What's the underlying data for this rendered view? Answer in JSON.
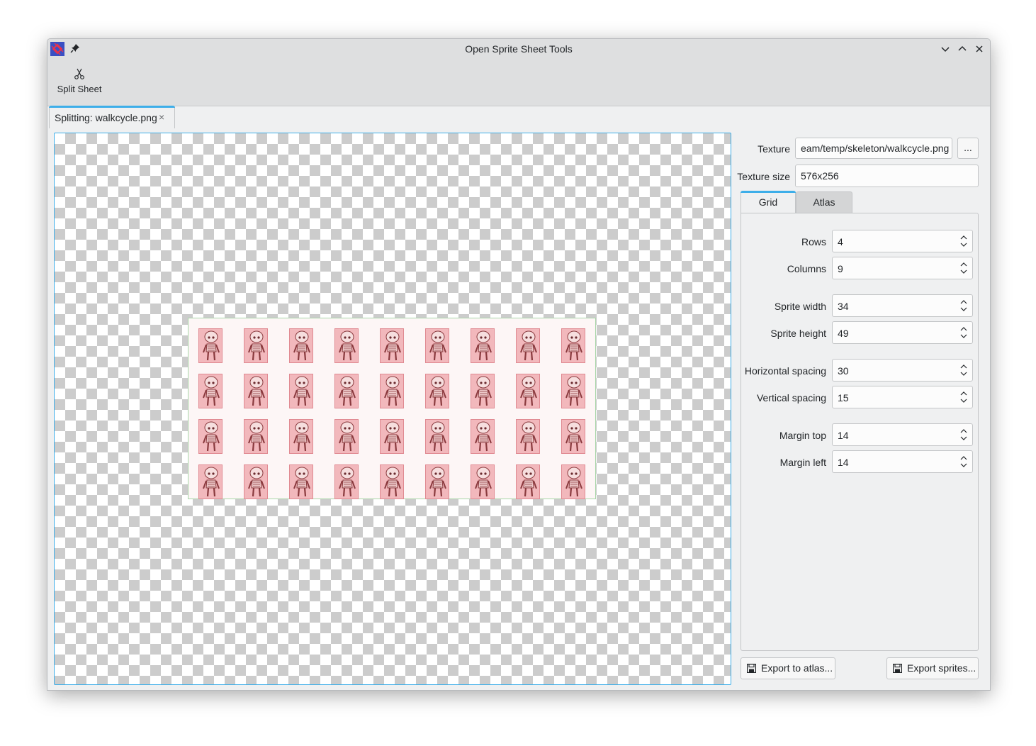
{
  "window": {
    "title": "Open Sprite Sheet Tools"
  },
  "toolbar": {
    "split_label": "Split Sheet"
  },
  "tab": {
    "label": "Splitting: walkcycle.png",
    "close_glyph": "×"
  },
  "texture": {
    "label": "Texture",
    "path": "eam/temp/skeleton/walkcycle.png",
    "browse_label": "...",
    "size_label": "Texture size",
    "size_value": "576x256"
  },
  "mode_tabs": {
    "grid": "Grid",
    "atlas": "Atlas"
  },
  "grid": {
    "rows": {
      "label": "Rows",
      "value": "4"
    },
    "columns": {
      "label": "Columns",
      "value": "9"
    },
    "sprite_width": {
      "label": "Sprite width",
      "value": "34"
    },
    "sprite_height": {
      "label": "Sprite height",
      "value": "49"
    },
    "h_spacing": {
      "label": "Horizontal spacing",
      "value": "30"
    },
    "v_spacing": {
      "label": "Vertical spacing",
      "value": "15"
    },
    "margin_top": {
      "label": "Margin top",
      "value": "14"
    },
    "margin_left": {
      "label": "Margin left",
      "value": "14"
    }
  },
  "actions": {
    "export_atlas": "Export to atlas...",
    "export_sprites": "Export sprites..."
  },
  "colors": {
    "accent": "#3daee9",
    "sprite_fill": "#f2b8bc",
    "sheet_border": "#a9d6a9"
  },
  "icons": {
    "app": "app-icon",
    "pin": "pin-icon",
    "minimize": "chevron-down-icon",
    "maximize": "chevron-up-icon",
    "close": "close-icon",
    "split": "scissors-icon",
    "save": "save-icon"
  }
}
